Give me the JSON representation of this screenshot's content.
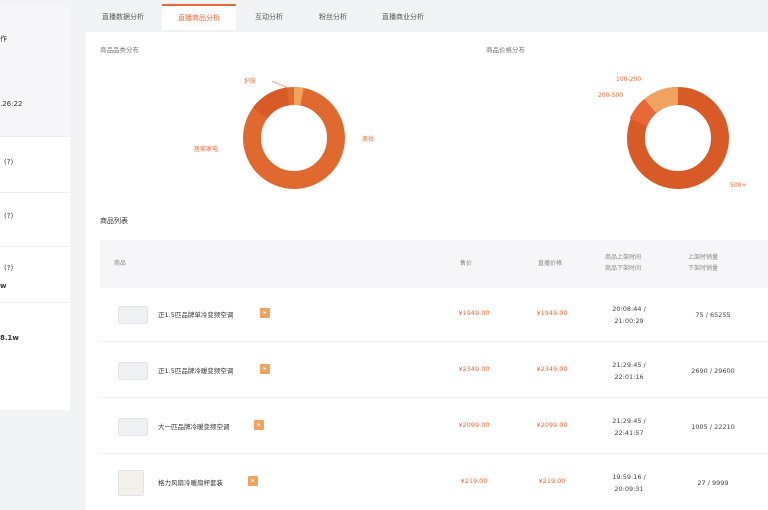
{
  "left_panel": {
    "items": [
      {
        "label": "作",
        "value": ""
      },
      {
        "label": "",
        "value": ".26:22"
      },
      {
        "label": "(?)",
        "value": ""
      },
      {
        "label": "(?)",
        "value": ""
      },
      {
        "label": "(?)",
        "value": "w"
      },
      {
        "label": "",
        "value": "8.1w"
      }
    ]
  },
  "tabs": [
    {
      "label": "直播数据分析"
    },
    {
      "label": "直播商品分析"
    },
    {
      "label": "互动分析"
    },
    {
      "label": "粉丝分析"
    },
    {
      "label": "直播商业分析"
    }
  ],
  "charts": {
    "left": {
      "title": "商品品类分布",
      "labels": [
        "护肤",
        "居家家电",
        "美妆"
      ],
      "colors": [
        "#e8683a",
        "#f0a35e",
        "#d95b2b"
      ]
    },
    "right": {
      "title": "商品价格分布",
      "labels": [
        "100-200",
        "200-500",
        "500+"
      ],
      "colors": [
        "#e8683a",
        "#f0a35e",
        "#d95b2b"
      ]
    }
  },
  "list": {
    "title": "商品列表",
    "headers": {
      "product": "商品",
      "price": "售价",
      "live_price": "直播价格",
      "time": [
        "商品上架时间",
        "商品下架时间"
      ],
      "sales": [
        "上架时销量",
        "下架时销量"
      ]
    },
    "rows": [
      {
        "name": "正1.5匹品牌单冷变频空调",
        "price": "¥1949.00",
        "live_price": "¥1949.00",
        "time": [
          "20:08:44 /",
          "21:00:29"
        ],
        "sales": "75 / 65255"
      },
      {
        "name": "正1.5匹品牌冷暖变频空调",
        "price": "¥2349.00",
        "live_price": "¥2349.00",
        "time": [
          "21:29:45 /",
          "22:01:16"
        ],
        "sales": "2690 / 29600"
      },
      {
        "name": "大一匹品牌冷暖变频空调",
        "price": "¥2099.00",
        "live_price": "¥2099.00",
        "time": [
          "21:29:45 /",
          "22:41:57"
        ],
        "sales": "1005 / 22210"
      },
      {
        "name": "格力风扇冷暖扇杯套装",
        "price": "¥219.00",
        "live_price": "¥219.00",
        "time": [
          "19:59:16 /",
          "20:09:31"
        ],
        "sales": "27 / 9999"
      }
    ]
  }
}
